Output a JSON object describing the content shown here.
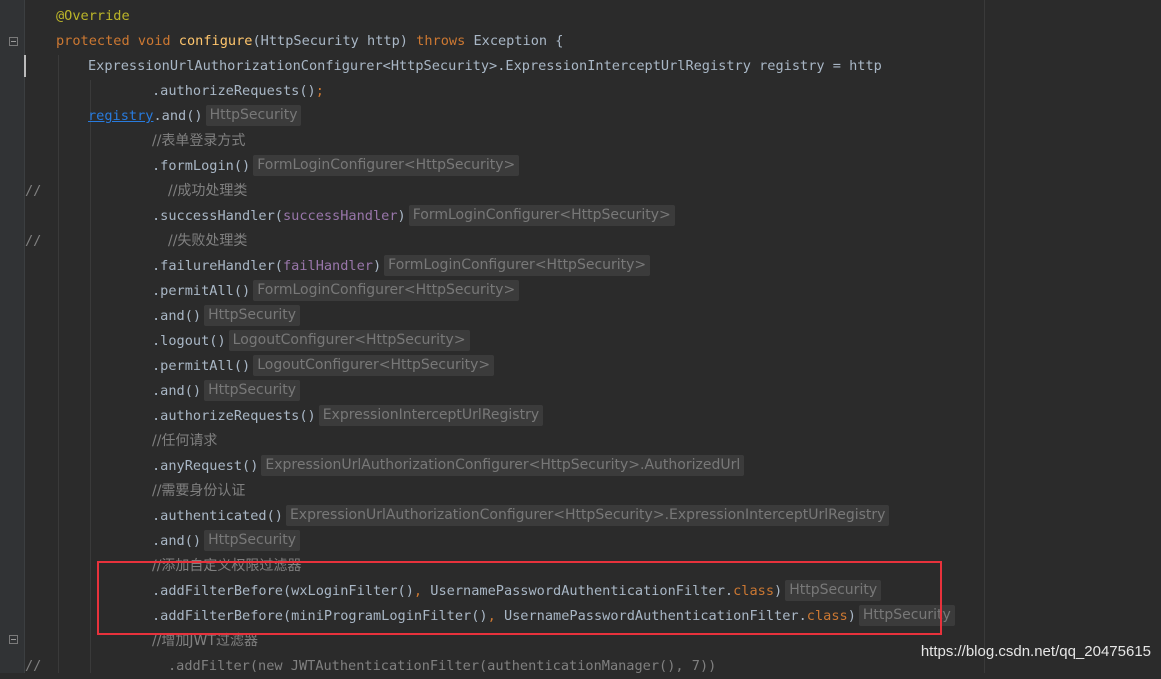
{
  "code": {
    "override": "@Override",
    "kw_protected": "protected",
    "kw_void": "void",
    "method_name": "configure",
    "method_params": "(HttpSecurity http) ",
    "kw_throws": "throws",
    "method_tail": " Exception {",
    "registry_decl": "ExpressionUrlAuthorizationConfigurer<HttpSecurity>.ExpressionInterceptUrlRegistry registry = http",
    "authorize_first": ".authorizeRequests()",
    "semicolon": ";",
    "registry_ref": "registry",
    "and_call": ".and()",
    "comment_form_login": "//表单登录方式",
    "form_login": ".formLogin()",
    "comment_prefix": "//",
    "comment_success": "//成功处理类",
    "success_handler_open": ".successHandler(",
    "success_handler_arg": "successHandler",
    "close_paren": ")",
    "comment_fail": "//失败处理类",
    "failure_handler_open": ".failureHandler(",
    "failure_handler_arg": "failHandler",
    "permit_all": ".permitAll()",
    "logout": ".logout()",
    "authorize_requests": ".authorizeRequests()",
    "comment_any_request": "//任何请求",
    "any_request": ".anyRequest()",
    "comment_auth": "//需要身份认证",
    "authenticated": ".authenticated()",
    "comment_custom_filter": "//添加自定义权限过滤器",
    "add_filter_before_open": ".addFilterBefore(",
    "wx_filter": "wxLoginFilter()",
    "mini_filter": "miniProgramLoginFilter()",
    "comma": ", ",
    "upaf": "UsernamePasswordAuthenticationFilter.",
    "kw_class": "class",
    "comment_jwt": "//增加JWT过滤器",
    "jwt_line": ".addFilter(new JWTAuthenticationFilter(authenticationManager(), 7))"
  },
  "hints": {
    "http_security": "HttpSecurity",
    "form_login_configurer": "FormLoginConfigurer<HttpSecurity>",
    "logout_configurer": "LogoutConfigurer<HttpSecurity>",
    "expr_registry": "ExpressionInterceptUrlRegistry",
    "authorized_url": "ExpressionUrlAuthorizationConfigurer<HttpSecurity>.AuthorizedUrl",
    "expr_full_registry": "ExpressionUrlAuthorizationConfigurer<HttpSecurity>.ExpressionInterceptUrlRegistry"
  },
  "watermark": "https://blog.csdn.net/qq_20475615",
  "colors": {
    "background": "#2b2b2b",
    "keyword": "#cc7832",
    "method": "#ffc66d",
    "annotation": "#bbb529",
    "comment": "#808080",
    "parameter": "#9876aa",
    "highlight_box": "#e8323c"
  }
}
